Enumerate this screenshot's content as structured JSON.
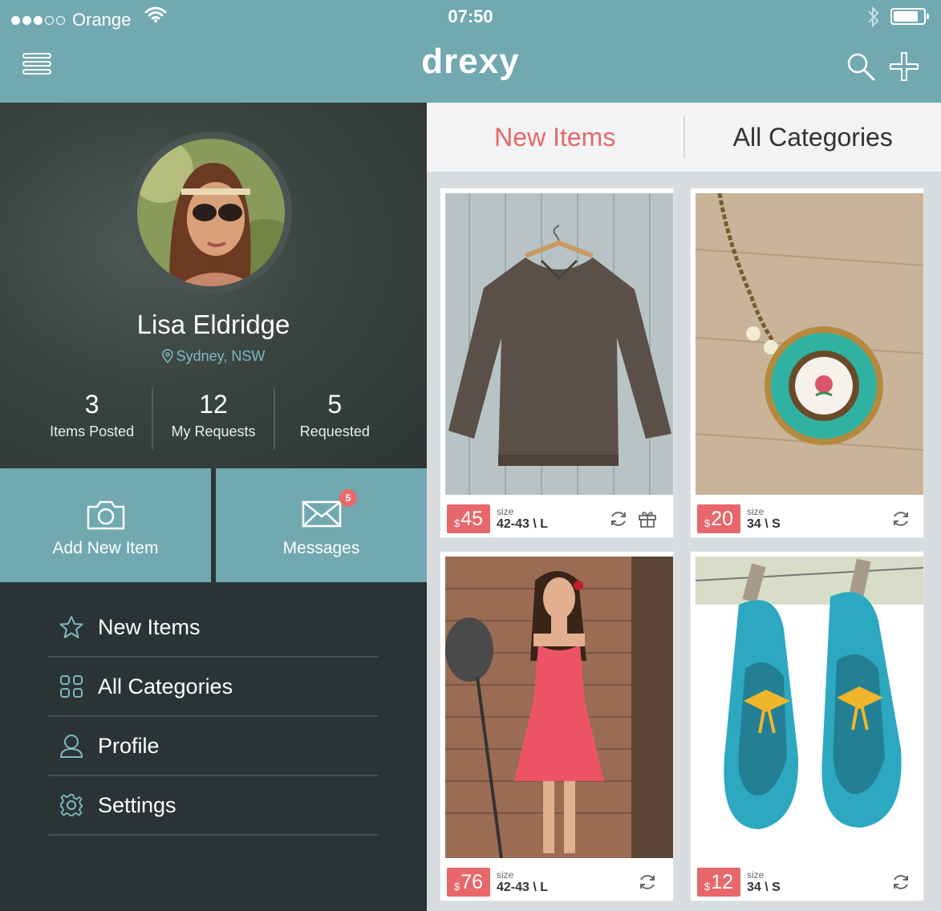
{
  "status_bar": {
    "carrier": "Orange",
    "time": "07:50",
    "signal_bars_filled": 3,
    "signal_bars_total": 5
  },
  "header": {
    "logo": "drexy",
    "accent_color": "#72a9b0"
  },
  "profile": {
    "name": "Lisa Eldridge",
    "location": "Sydney, NSW",
    "stats": [
      {
        "value": "3",
        "label": "Items Posted"
      },
      {
        "value": "12",
        "label": "My Requests"
      },
      {
        "value": "5",
        "label": "Requested"
      }
    ]
  },
  "actions": {
    "add_item": "Add New Item",
    "messages": "Messages",
    "messages_badge": "5"
  },
  "nav": {
    "items": [
      {
        "label": "New Items",
        "icon": "star-icon"
      },
      {
        "label": "All Categories",
        "icon": "grid-icon"
      },
      {
        "label": "Profile",
        "icon": "user-icon"
      },
      {
        "label": "Settings",
        "icon": "gear-icon"
      }
    ]
  },
  "tabs": {
    "new_items": "New Items",
    "all_categories": "All Categories",
    "active_color": "#e8676a"
  },
  "items": [
    {
      "currency": "$",
      "price": "45",
      "size_label": "size",
      "size": "42-43 \\ L",
      "image": "brown-sweater"
    },
    {
      "currency": "$",
      "price": "20",
      "size_label": "size",
      "size": "34 \\ S",
      "image": "turquoise-locket-necklace"
    },
    {
      "currency": "$",
      "price": "76",
      "size_label": "size",
      "size": "42-43 \\ L",
      "image": "red-dress"
    },
    {
      "currency": "$",
      "price": "12",
      "size_label": "size",
      "size": "34 \\ S",
      "image": "blue-felt-slippers"
    }
  ]
}
